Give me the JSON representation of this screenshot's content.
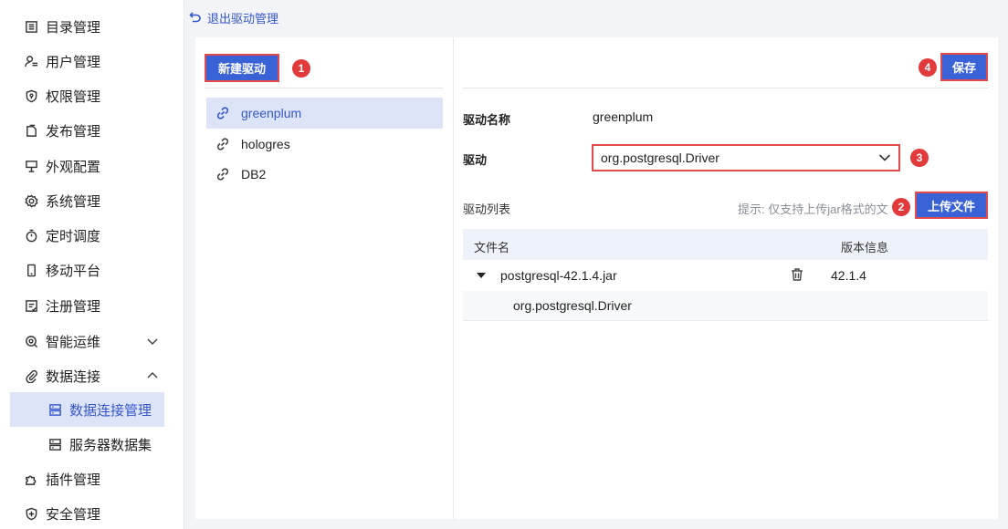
{
  "sidebar": {
    "items": [
      {
        "label": "目录管理",
        "icon": "list-icon"
      },
      {
        "label": "用户管理",
        "icon": "user-list-icon"
      },
      {
        "label": "权限管理",
        "icon": "shield-lock-icon"
      },
      {
        "label": "发布管理",
        "icon": "publish-icon"
      },
      {
        "label": "外观配置",
        "icon": "appearance-icon"
      },
      {
        "label": "系统管理",
        "icon": "gear-icon"
      },
      {
        "label": "定时调度",
        "icon": "timer-icon"
      },
      {
        "label": "移动平台",
        "icon": "mobile-icon"
      },
      {
        "label": "注册管理",
        "icon": "register-icon"
      },
      {
        "label": "智能运维",
        "icon": "ops-icon",
        "expand": "collapsed"
      },
      {
        "label": "数据连接",
        "icon": "paperclip-icon",
        "expand": "expanded"
      },
      {
        "label": "插件管理",
        "icon": "puzzle-icon"
      },
      {
        "label": "安全管理",
        "icon": "security-icon"
      }
    ],
    "sub_items": [
      {
        "label": "数据连接管理",
        "icon": "database-icon",
        "active": true
      },
      {
        "label": "服务器数据集",
        "icon": "server-dataset-icon",
        "active": false
      }
    ]
  },
  "header": {
    "back_label": "退出驱动管理"
  },
  "left_pane": {
    "new_button": "新建驱动",
    "drivers": [
      {
        "name": "greenplum",
        "active": true
      },
      {
        "name": "hologres",
        "active": false
      },
      {
        "name": "DB2",
        "active": false
      }
    ]
  },
  "right_pane": {
    "save_button": "保存",
    "driver_name_label": "驱动名称",
    "driver_name_value": "greenplum",
    "driver_label": "驱动",
    "driver_selected": "org.postgresql.Driver",
    "driver_list_label": "驱动列表",
    "hint": "提示: 仅支持上传jar格式的文",
    "upload_button": "上传文件",
    "table": {
      "col_file": "文件名",
      "col_version": "版本信息",
      "rows": [
        {
          "file": "postgresql-42.1.4.jar",
          "version": "42.1.4",
          "children": [
            "org.postgresql.Driver"
          ]
        }
      ]
    }
  },
  "badges": {
    "new": "1",
    "upload": "2",
    "select": "3",
    "save": "4"
  },
  "colors": {
    "accent": "#3a62d7",
    "active_bg": "#dee4f8",
    "highlight_border": "#e24b4b",
    "badge": "#e23a3a"
  }
}
